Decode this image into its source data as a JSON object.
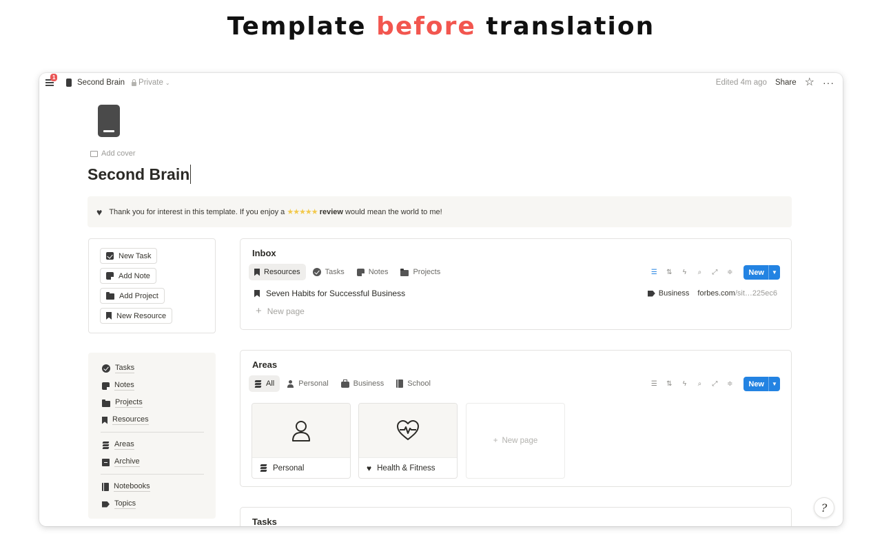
{
  "banner": {
    "prefix": "Template",
    "accent": "before",
    "suffix": "translation"
  },
  "topbar": {
    "notifications": "1",
    "breadcrumb": "Second Brain",
    "privacy": "Private",
    "edited": "Edited 4m ago",
    "share": "Share",
    "favorite_icon": "star-icon",
    "more_icon": "more-icon"
  },
  "page": {
    "add_cover": "Add cover",
    "title": "Second Brain"
  },
  "callout": {
    "icon": "heart-icon",
    "before": "Thank you for interest in this template. If you enjoy a",
    "stars": "★★★★★",
    "bold": "review",
    "after": "would mean the world to me!"
  },
  "quick_buttons": [
    {
      "label": "New Task",
      "icon": "checkbox-icon"
    },
    {
      "label": "Add Note",
      "icon": "note-icon"
    },
    {
      "label": "Add Project",
      "icon": "folder-icon"
    },
    {
      "label": "New Resource",
      "icon": "bookmark-icon"
    }
  ],
  "nav": {
    "group1": [
      {
        "label": "Tasks",
        "icon": "check-circle-icon"
      },
      {
        "label": "Notes",
        "icon": "note-icon"
      },
      {
        "label": "Projects",
        "icon": "folder-icon"
      },
      {
        "label": "Resources",
        "icon": "bookmark-icon"
      }
    ],
    "group2": [
      {
        "label": "Areas",
        "icon": "layers-icon"
      },
      {
        "label": "Archive",
        "icon": "archive-icon"
      }
    ],
    "group3": [
      {
        "label": "Notebooks",
        "icon": "notebook-icon"
      },
      {
        "label": "Topics",
        "icon": "tag-icon"
      }
    ]
  },
  "inbox": {
    "title": "Inbox",
    "tabs": [
      {
        "label": "Resources",
        "active": true
      },
      {
        "label": "Tasks",
        "active": false
      },
      {
        "label": "Notes",
        "active": false
      },
      {
        "label": "Projects",
        "active": false
      }
    ],
    "new_label": "New",
    "rows": [
      {
        "title": "Seven Habits for Successful Business",
        "tag": "Business",
        "url_main": "forbes.com",
        "url_mid": "/sit…",
        "url_end": "225ec6"
      }
    ],
    "new_page": "New page"
  },
  "areas": {
    "title": "Areas",
    "tabs": [
      {
        "label": "All",
        "active": true
      },
      {
        "label": "Personal",
        "active": false
      },
      {
        "label": "Business",
        "active": false
      },
      {
        "label": "School",
        "active": false
      }
    ],
    "new_label": "New",
    "cards": [
      {
        "title": "Personal",
        "icon": "person-outline-icon"
      },
      {
        "title": "Health & Fitness",
        "icon": "heart-pulse-icon"
      }
    ],
    "new_page": "New page"
  },
  "tasks": {
    "title": "Tasks"
  },
  "help": {
    "glyph": "?"
  }
}
